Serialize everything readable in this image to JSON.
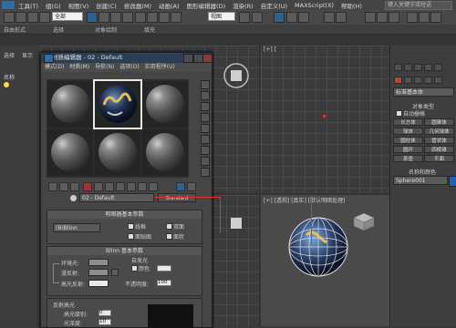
{
  "menubar": {
    "items": [
      "工具(T)",
      "组(G)",
      "视图(V)",
      "创建(C)",
      "修改器(M)",
      "动画(A)",
      "图形编辑器(D)",
      "渲染(R)",
      "自定义(U)",
      "MAXScript(X)",
      "帮助(H)"
    ],
    "search_placeholder": "键入关键字或短语"
  },
  "toolbar": {
    "filter_select": "全部",
    "coord_select": "视图"
  },
  "ribbon": {
    "items": [
      "自由形式",
      "选择",
      "对象绘制",
      "填充"
    ]
  },
  "left_panel": {
    "tabs": [
      "选择",
      "显示"
    ],
    "label": "名称"
  },
  "viewports": {
    "top_label": "[+] [",
    "bottom_label": "[+] [透视] [真实] [默认明暗处理]"
  },
  "material_editor": {
    "title": "材质编辑器 - 02 - Default",
    "menu": [
      "模式(D)",
      "材质(M)",
      "导航(N)",
      "选项(O)",
      "实用程序(U)"
    ],
    "material_name": "02 - Default",
    "material_type_button": "Standard",
    "shader_rollout": {
      "title": "明暗器基本参数",
      "shader": "(B)Blinn",
      "options": [
        "线框",
        "双面",
        "面贴图",
        "面状"
      ]
    },
    "blinn_rollout": {
      "title": "Blinn 基本参数",
      "self_illum_title": "自发光",
      "color_label": "颜色",
      "ambient_label": "环境光:",
      "diffuse_label": "漫反射:",
      "specular_label": "高光反射:",
      "opacity_label": "不透明度:",
      "opacity_value": "100",
      "lock_label": "C"
    },
    "spec_rollout": {
      "title": "反射高光",
      "level_label": "高光级别:",
      "level_value": "0",
      "gloss_label": "光泽度:",
      "gloss_value": "10"
    }
  },
  "command_panel": {
    "dropdown": "标准基本体",
    "object_type_title": "对象类型",
    "autogrid": "自动栅格",
    "buttons": [
      "长方体",
      "圆锥体",
      "球体",
      "几何球体",
      "圆柱体",
      "管状体",
      "圆环",
      "四棱锥",
      "茶壶",
      "平面"
    ],
    "name_color_title": "名称和颜色",
    "object_name": "Sphere001"
  },
  "colors": {
    "title_bar": "#2d3e52",
    "accent_blue": "#2d5f8f",
    "annotation_red": "#e03030"
  }
}
